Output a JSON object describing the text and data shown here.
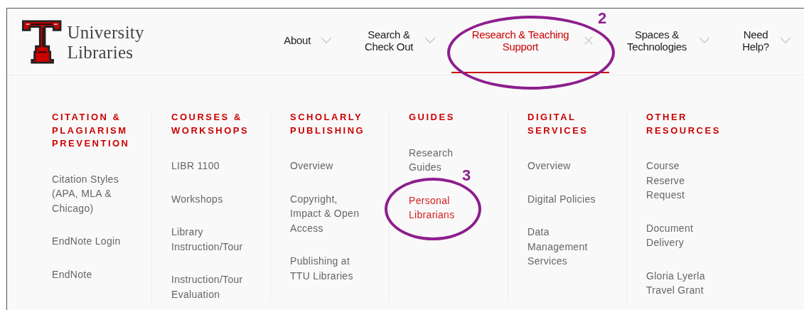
{
  "header": {
    "title": "University Libraries"
  },
  "nav": [
    {
      "label": "About",
      "selected": false
    },
    {
      "label": "Search & Check Out",
      "selected": false
    },
    {
      "label": "Research & Teaching Support",
      "selected": true
    },
    {
      "label": "Spaces & Technologies",
      "selected": false
    },
    {
      "label": "Need Help?",
      "selected": false
    }
  ],
  "menu_columns": [
    {
      "heading": "CITATION & PLAGIARISM PREVENTION",
      "items": [
        {
          "label": "Citation Styles (APA, MLA & Chicago)",
          "selected": false
        },
        {
          "label": "EndNote Login",
          "selected": false
        },
        {
          "label": "EndNote",
          "selected": false
        }
      ]
    },
    {
      "heading": "COURSES & WORKSHOPS",
      "items": [
        {
          "label": "LIBR 1100",
          "selected": false
        },
        {
          "label": "Workshops",
          "selected": false
        },
        {
          "label": "Library Instruction/Tour",
          "selected": false
        },
        {
          "label": "Instruction/Tour Evaluation",
          "selected": false
        }
      ]
    },
    {
      "heading": "SCHOLARLY PUBLISHING",
      "items": [
        {
          "label": "Overview",
          "selected": false
        },
        {
          "label": "Copyright, Impact & Open Access",
          "selected": false
        },
        {
          "label": "Publishing at TTU Libraries",
          "selected": false
        }
      ]
    },
    {
      "heading": "GUIDES",
      "items": [
        {
          "label": "Research Guides",
          "selected": false
        },
        {
          "label": "Personal Librarians",
          "selected": true
        }
      ]
    },
    {
      "heading": "DIGITAL SERVICES",
      "items": [
        {
          "label": "Overview",
          "selected": false
        },
        {
          "label": "Digital Policies",
          "selected": false
        },
        {
          "label": "Data Management Services",
          "selected": false
        }
      ]
    },
    {
      "heading": "OTHER RESOURCES",
      "items": [
        {
          "label": "Course Reserve Request",
          "selected": false
        },
        {
          "label": "Document Delivery",
          "selected": false
        },
        {
          "label": "Gloria Lyerla Travel Grant",
          "selected": false
        }
      ]
    }
  ],
  "annotations": [
    {
      "number": "2"
    },
    {
      "number": "3"
    }
  ]
}
